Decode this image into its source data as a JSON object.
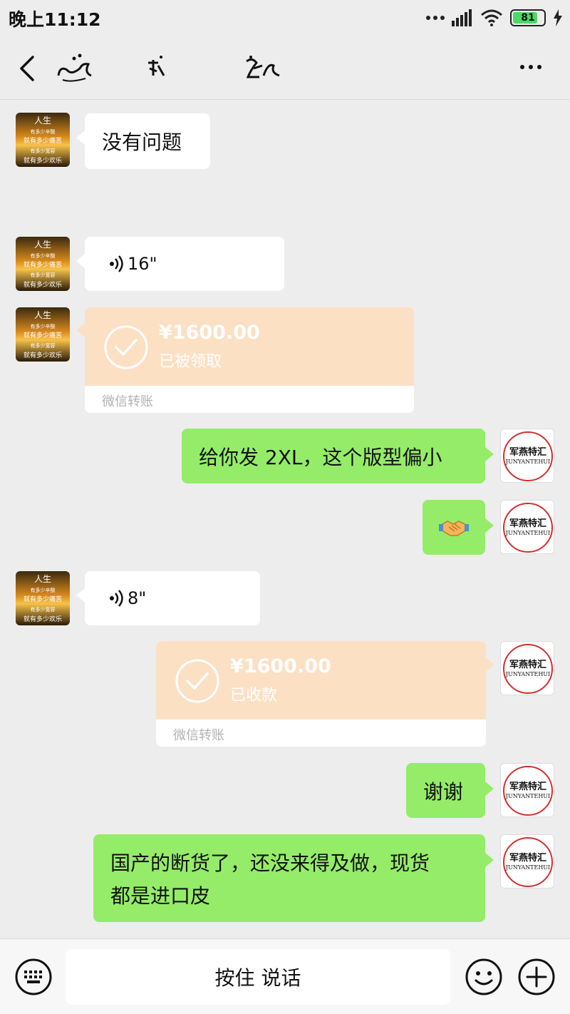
{
  "status_bar": {
    "time": "晚上11:12",
    "battery": "81"
  },
  "messages": {
    "m1": {
      "text": "没有问题"
    },
    "m2": {
      "duration": "16\""
    },
    "m3": {
      "amount": "¥1600.00",
      "status": "已被领取",
      "label": "微信转账"
    },
    "m4": {
      "text": "给你发 2XL，这个版型偏小"
    },
    "m5": {
      "emoji": "handshake"
    },
    "m6": {
      "duration": "8\""
    },
    "m7": {
      "amount": "¥1600.00",
      "status": "已收款",
      "label": "微信转账"
    },
    "m8": {
      "text": "谢谢"
    },
    "m9": {
      "line1": "国产的断货了，还没来得及做，现货",
      "line2": "都是进口皮"
    }
  },
  "contact_avatar": {
    "line1": "人生",
    "line2": "有多少辛酸",
    "line3": "就有多少痛苦",
    "line4": "有多少宽容",
    "line5": "就有多少欢乐"
  },
  "my_avatar": {
    "cn": "军燕特汇",
    "en": "JUNYANTEHUI"
  },
  "input_bar": {
    "talk_label": "按住 说话"
  },
  "colors": {
    "bubble_green": "#95ec69",
    "transfer_orange": "#fce0c4",
    "background": "#ededed"
  }
}
